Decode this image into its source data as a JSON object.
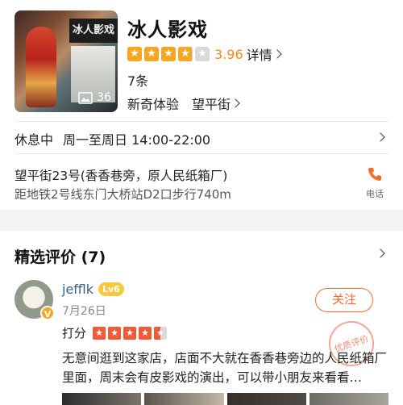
{
  "shop": {
    "name": "冰人影戏",
    "rating": 3.96,
    "rating_text": "3.96",
    "detail_label": "详情",
    "review_count": "7条",
    "tags": [
      "新奇体验",
      "望平街"
    ],
    "thumb_sign": "冰人影戏",
    "photo_count": "36"
  },
  "hours": {
    "status": "休息中",
    "time": "周一至周日 14:00-22:00"
  },
  "address": {
    "line": "望平街23号(香香巷旁，原人民纸箱厂)",
    "subway": "距地铁2号线东门大桥站D2口步行740m",
    "phone_label": "电话"
  },
  "reviews": {
    "heading": "精选评价 (7)",
    "item": {
      "user": "jefflk",
      "level": "Lv6",
      "badge": "V",
      "date": "7月26日",
      "score_label": "打分",
      "score": 4.5,
      "follow_label": "关注",
      "stamp": "优质评价",
      "text": "无意间逛到这家店，店面不大就在香香巷旁边的人民纸箱厂里面，周末会有皮影戏的演出，可以带小朋友来看看…"
    }
  },
  "colors": {
    "accent": "#f08c1b",
    "star_orange": "#f5a623",
    "review_star_red": "#f05a38",
    "follow_orange": "#f36c2c"
  }
}
